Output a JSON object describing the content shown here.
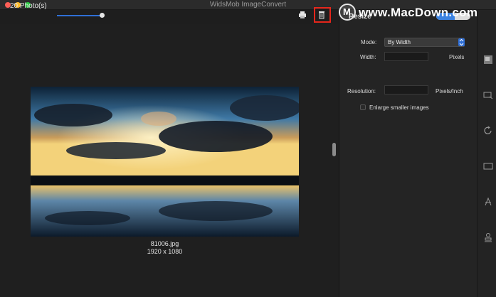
{
  "window": {
    "title": "WidsMob ImageConvert"
  },
  "toolbar": {
    "photo_count": "20 Photo(s)"
  },
  "photo": {
    "filename": "81006.jpg",
    "dimensions": "1920 x 1080"
  },
  "panel": {
    "title": "Resize",
    "mode_label": "Mode:",
    "mode_value": "By Width",
    "width_label": "Width:",
    "width_value": "",
    "width_unit": "Pixels",
    "resolution_label": "Resolution:",
    "resolution_value": "",
    "resolution_unit": "Pixels/Inch",
    "enlarge_label": "Enlarge smaller images",
    "enlarge_checked": false,
    "toggle_on": true
  },
  "sidebar": {
    "icons": [
      "resize-icon",
      "watermark-icon",
      "rotate-icon",
      "border-icon",
      "text-icon",
      "stamp-icon"
    ]
  },
  "watermark": {
    "text": "www.MacDown.com",
    "letter": "M"
  },
  "colors": {
    "accent": "#2f6fd6",
    "highlight": "#e5261b"
  }
}
